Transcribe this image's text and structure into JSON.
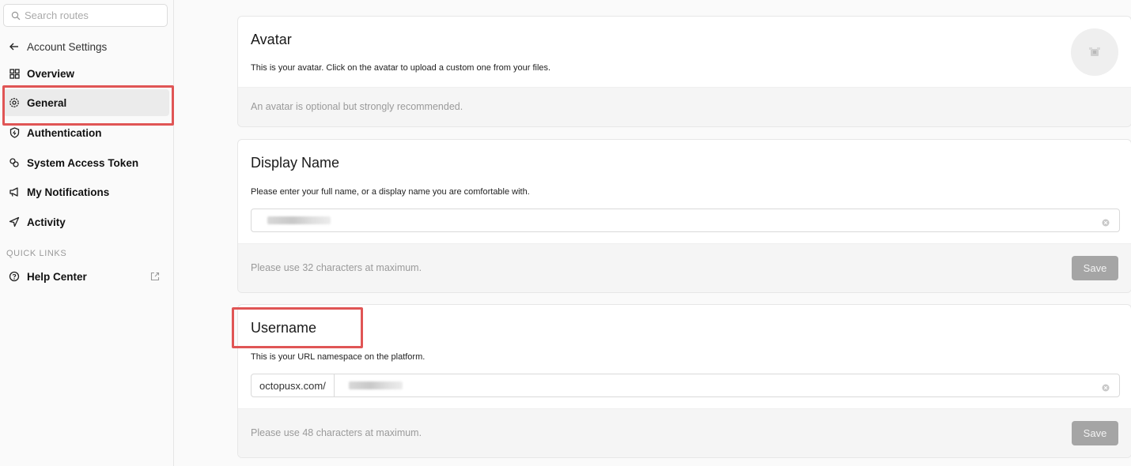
{
  "search": {
    "placeholder": "Search routes",
    "icon": "search-icon"
  },
  "sidebar": {
    "back_label": "Account Settings",
    "items": [
      {
        "label": "Overview",
        "icon": "grid-icon"
      },
      {
        "label": "General",
        "icon": "gear-icon",
        "active": true
      },
      {
        "label": "Authentication",
        "icon": "shield-icon"
      },
      {
        "label": "System Access Token",
        "icon": "token-icon"
      },
      {
        "label": "My Notifications",
        "icon": "megaphone-icon"
      },
      {
        "label": "Activity",
        "icon": "send-icon"
      }
    ],
    "quick_links_label": "QUICK LINKS",
    "quick_links": [
      {
        "label": "Help Center",
        "icon": "help-icon",
        "external": true
      }
    ]
  },
  "avatar_card": {
    "title": "Avatar",
    "description": "This is your avatar. Click on the avatar to upload a custom one from your files.",
    "hint": "An avatar is optional but strongly recommended."
  },
  "display_name_card": {
    "title": "Display Name",
    "description": "Please enter your full name, or a display name you are comfortable with.",
    "hint": "Please use 32 characters at maximum.",
    "save_label": "Save"
  },
  "username_card": {
    "title": "Username",
    "description": "This is your URL namespace on the platform.",
    "prefix": "octopusx.com/",
    "hint": "Please use 48 characters at maximum.",
    "save_label": "Save"
  },
  "colors": {
    "highlight": "#e05555",
    "save_disabled": "#a5a5a5",
    "active_bg": "#ebebeb"
  }
}
